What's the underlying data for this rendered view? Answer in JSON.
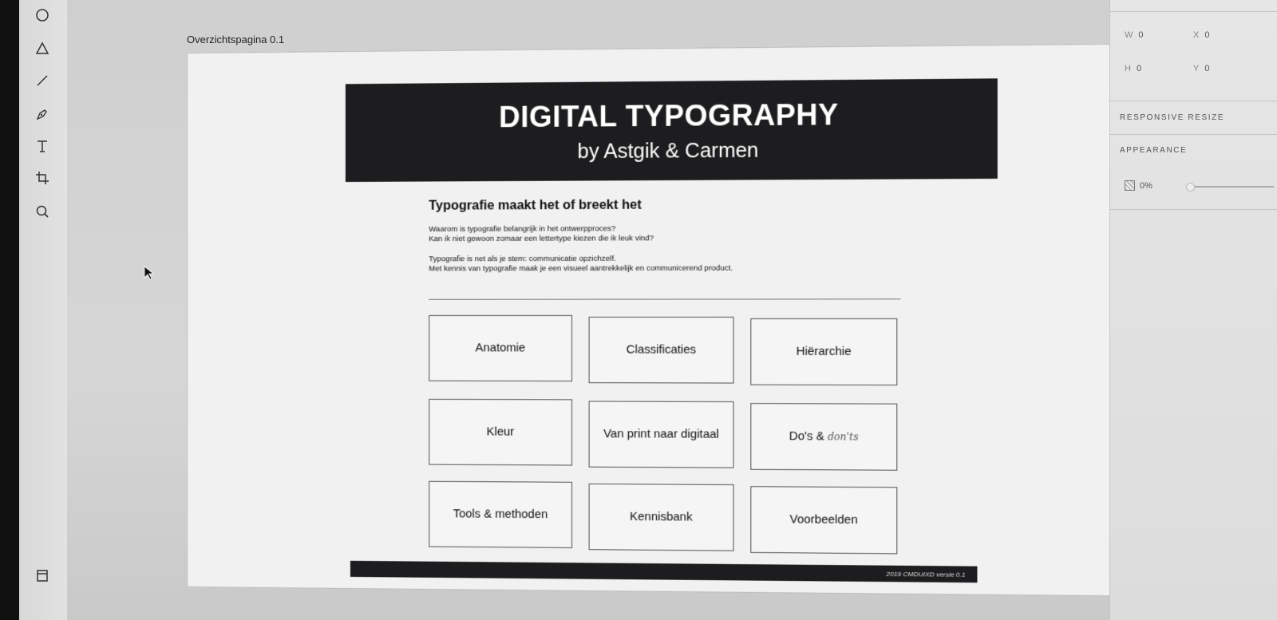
{
  "tools": [
    {
      "name": "ellipse-tool",
      "icon": "ellipse-icon"
    },
    {
      "name": "polygon-tool",
      "icon": "triangle-icon"
    },
    {
      "name": "line-tool",
      "icon": "line-icon"
    },
    {
      "name": "pen-tool",
      "icon": "pen-icon"
    },
    {
      "name": "text-tool",
      "icon": "text-icon"
    },
    {
      "name": "artboard-tool",
      "icon": "artboard-icon"
    },
    {
      "name": "zoom-tool",
      "icon": "magnifier-icon"
    }
  ],
  "artboard": {
    "label": "Overzichtspagina 0.1",
    "hero_title": "DIGITAL TYPOGRAPHY",
    "hero_subtitle": "by Astgik & Carmen",
    "intro": {
      "heading": "Typografie maakt het of breekt het",
      "line1": "Waarom is typografie belangrijk in het ontwerpproces?",
      "line2": "Kan ik niet gewoon zomaar een lettertype kiezen die ik leuk vind?",
      "line3": "Typografie is net als je stem: communicatie opzichzelf.",
      "line4": "Met kennis van typografie maak je een visueel aantrekkelijk en communicerend product."
    },
    "tiles": {
      "t1": "Anatomie",
      "t2": "Classificaties",
      "t3": "Hiërarchie",
      "t4": "Kleur",
      "t5": "Van print naar digitaal",
      "t6_main": "Do's &",
      "t6_script": "don'ts",
      "t7": "Tools & methoden",
      "t8": "Kennisbank",
      "t9": "Voorbeelden"
    },
    "footer": "2019 CMDUIXD versie 0.1"
  },
  "inspector": {
    "w_label": "W",
    "w_value": "0",
    "x_label": "X",
    "x_value": "0",
    "h_label": "H",
    "h_value": "0",
    "y_label": "Y",
    "y_value": "0",
    "responsive_resize": "RESPONSIVE RESIZE",
    "appearance": "APPEARANCE",
    "opacity": "0%"
  },
  "colors": {
    "hero_bg": "#1d1d1f",
    "artboard_bg": "#f1f1f1",
    "panel_bg": "#e2e2e2"
  }
}
